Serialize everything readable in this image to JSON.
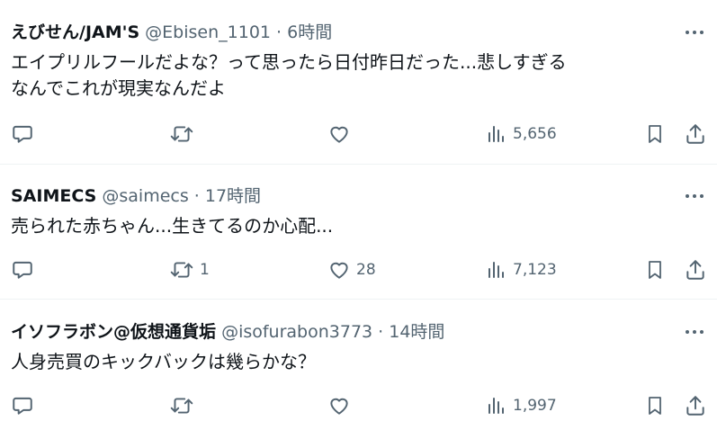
{
  "tweets": [
    {
      "display_name": "えびせん/JAM'S",
      "handle_time": "@Ebisen_1101 · 6時間",
      "text_line1": "エイプリルフールだよな？って思ったら日付昨日だった...悲しすぎる",
      "text_line2": "なんでこれが現実なんだよ",
      "retweets": "",
      "likes": "",
      "views": "5,656"
    },
    {
      "display_name": "SAIMECS",
      "handle_time": "@saimecs · 17時間",
      "text_line1": "売られた赤ちゃん...生きてるのか心配...",
      "text_line2": "",
      "retweets": "1",
      "likes": "28",
      "views": "7,123"
    },
    {
      "display_name": "イソフラボン@仮想通貨垢",
      "handle_time": "@isofurabon3773 · 14時間",
      "text_line1": "人身売買のキックバックは幾らかな？",
      "text_line2": "",
      "retweets": "",
      "likes": "",
      "views": "1,997"
    }
  ],
  "icons": {
    "more": "more-horizontal-icon",
    "reply": "reply-bubble-icon",
    "retweet": "retweet-arrows-icon",
    "like": "heart-icon",
    "views": "views-bar-chart-icon",
    "bookmark": "bookmark-icon",
    "share": "share-upload-icon"
  },
  "colors": {
    "text": "#0f1419",
    "secondary": "#536471",
    "divider": "#eff3f4"
  }
}
